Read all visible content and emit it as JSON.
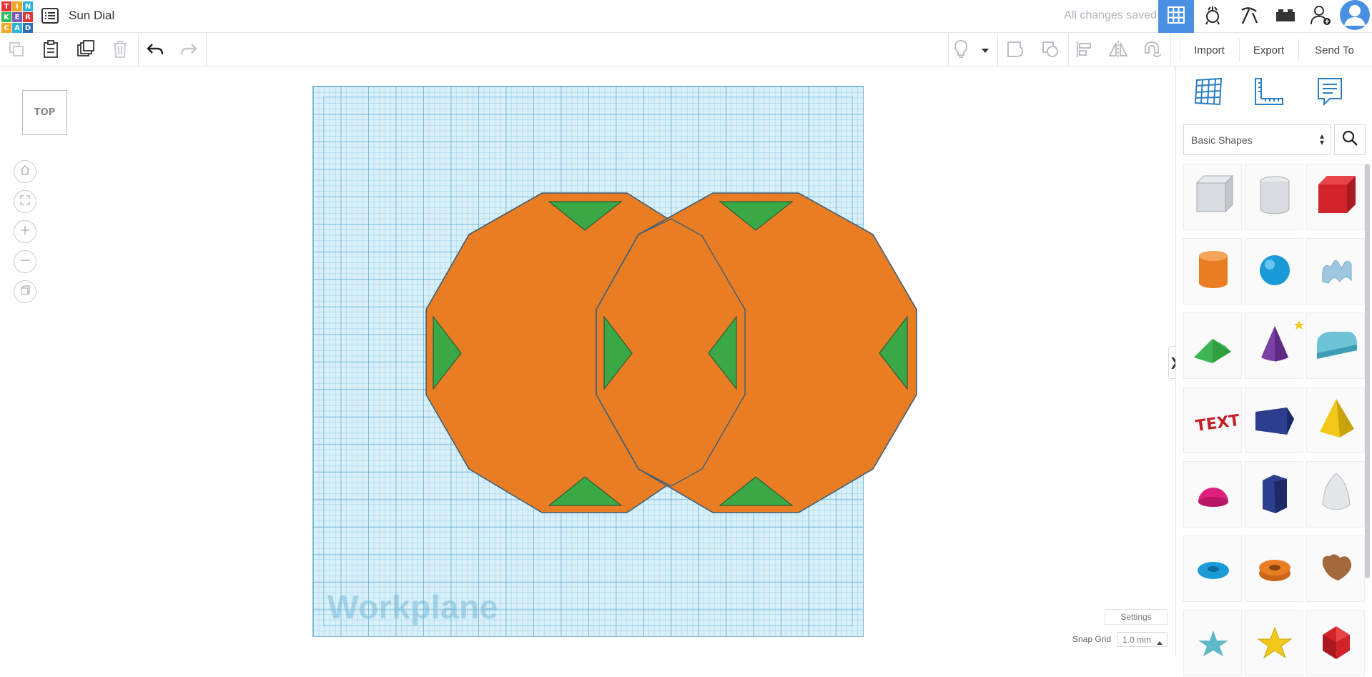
{
  "header": {
    "logo_letters": [
      "T",
      "I",
      "N",
      "K",
      "E",
      "R",
      "C",
      "A",
      "D"
    ],
    "logo_colors": [
      "#e33434",
      "#f5a623",
      "#2db3d6",
      "#2fbf5a",
      "#7b5bb5",
      "#e33434",
      "#f5a623",
      "#2db3d6",
      "#2b6fb7"
    ],
    "doc_title": "Sun Dial",
    "save_status": "All changes saved"
  },
  "toolbar": {
    "import_label": "Import",
    "export_label": "Export",
    "send_to_label": "Send To"
  },
  "viewcube": {
    "face_label": "TOP"
  },
  "workplane": {
    "label": "Workplane"
  },
  "bottom": {
    "settings_label": "Settings",
    "snap_grid_label": "Snap Grid",
    "snap_grid_value": "1.0 mm"
  },
  "panel": {
    "category": "Basic Shapes",
    "shapes": [
      "Box (Hole)",
      "Cylinder (Hole)",
      "Box",
      "Cylinder",
      "Sphere",
      "Scribble",
      "Roof",
      "Cone",
      "Round Roof",
      "Text",
      "Wedge",
      "Pyramid",
      "Half Sphere",
      "Polygon",
      "Paraboloid",
      "Torus",
      "Tube",
      "Heart",
      "Star",
      "Star 2",
      "Icosahedron"
    ]
  },
  "colors": {
    "accent": "#4a90e2",
    "shape_orange": "#e97d23",
    "triangle_green": "#3aa845",
    "workplane_blue": "#d9f0f9"
  }
}
